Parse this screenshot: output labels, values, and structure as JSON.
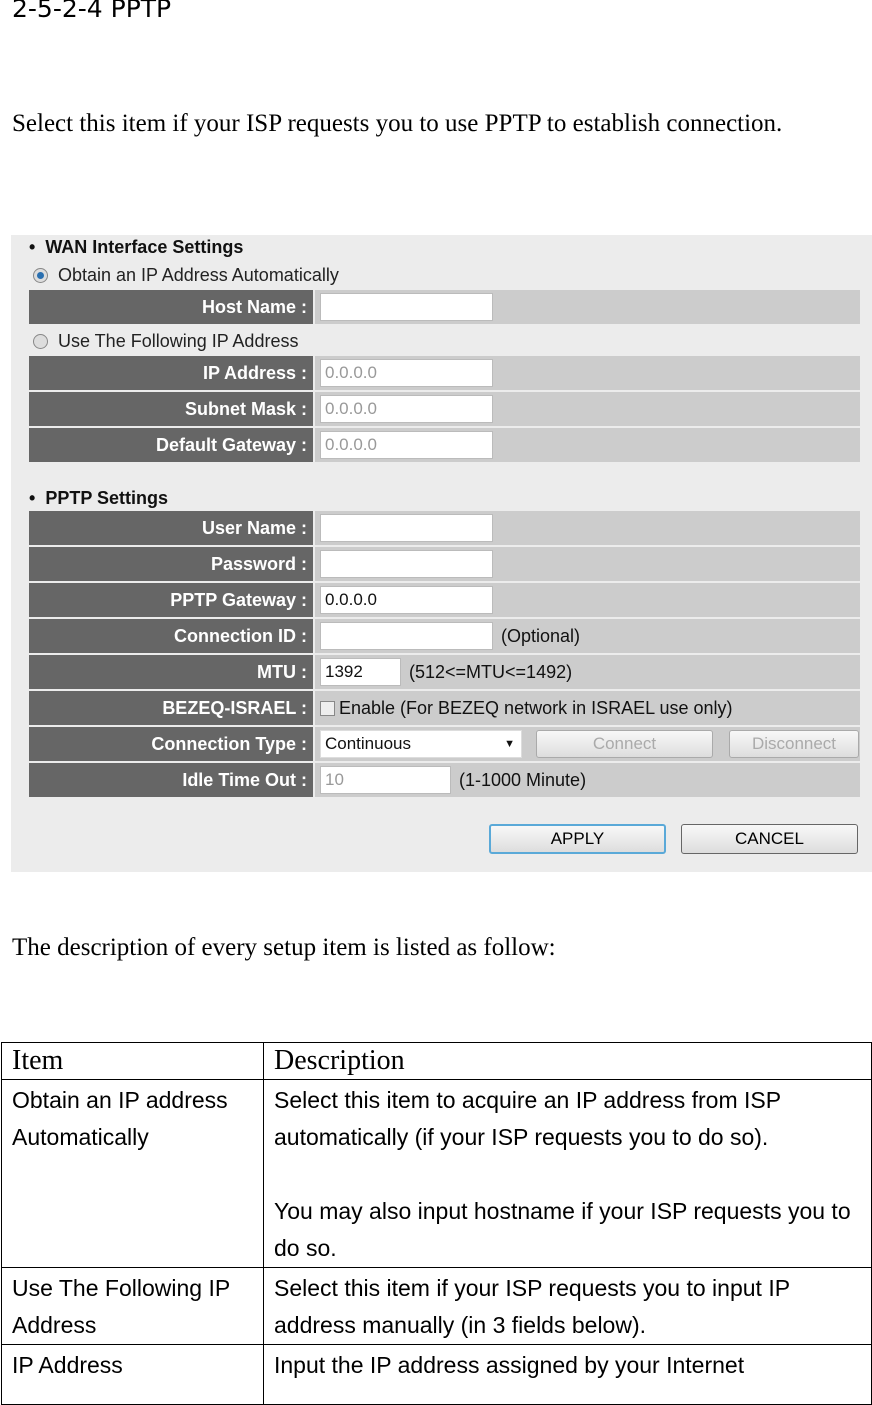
{
  "heading": "2-5-2-4 PPTP",
  "intro": "Select this item if your ISP requests you to use PPTP to establish connection.",
  "panel": {
    "wan_title": "WAN Interface Settings",
    "obtain_auto": "Obtain an IP Address Automatically",
    "use_following": "Use The Following IP Address",
    "host_name": {
      "label": "Host Name :",
      "value": ""
    },
    "ip_address": {
      "label": "IP Address :",
      "value": "0.0.0.0"
    },
    "subnet_mask": {
      "label": "Subnet Mask :",
      "value": "0.0.0.0"
    },
    "default_gateway": {
      "label": "Default Gateway :",
      "value": "0.0.0.0"
    },
    "pptp_title": "PPTP Settings",
    "user_name": {
      "label": "User Name :",
      "value": ""
    },
    "password": {
      "label": "Password :",
      "value": ""
    },
    "pptp_gateway": {
      "label": "PPTP Gateway :",
      "value": "0.0.0.0"
    },
    "connection_id": {
      "label": "Connection ID :",
      "value": "",
      "hint": "(Optional)"
    },
    "mtu": {
      "label": "MTU :",
      "value": "1392",
      "hint": "(512<=MTU<=1492)"
    },
    "bezeq": {
      "label": "BEZEQ-ISRAEL :",
      "checkbox_label": "Enable (For BEZEQ network in ISRAEL use only)",
      "checked": false
    },
    "connection_type": {
      "label": "Connection Type :",
      "selected": "Continuous",
      "connect": "Connect",
      "disconnect": "Disconnect"
    },
    "idle_time": {
      "label": "Idle Time Out :",
      "value": "10",
      "hint": "(1-1000 Minute)"
    },
    "apply": "APPLY",
    "cancel": "CANCEL"
  },
  "follow": "The description of every setup item is listed as follow:",
  "table": {
    "headers": [
      "Item",
      "Description"
    ],
    "rows": [
      {
        "item": "Obtain an IP address Automatically",
        "desc1": "Select this item to acquire an IP address from ISP automatically (if your ISP requests you to do so).",
        "desc2": "You may also input hostname if your ISP requests you to do so."
      },
      {
        "item": "Use The Following IP Address",
        "desc1": "Select this item if your ISP requests you to input IP address manually (in 3 fields below)."
      },
      {
        "item": "IP Address",
        "desc1": "Input the IP address assigned by your Internet"
      }
    ]
  }
}
